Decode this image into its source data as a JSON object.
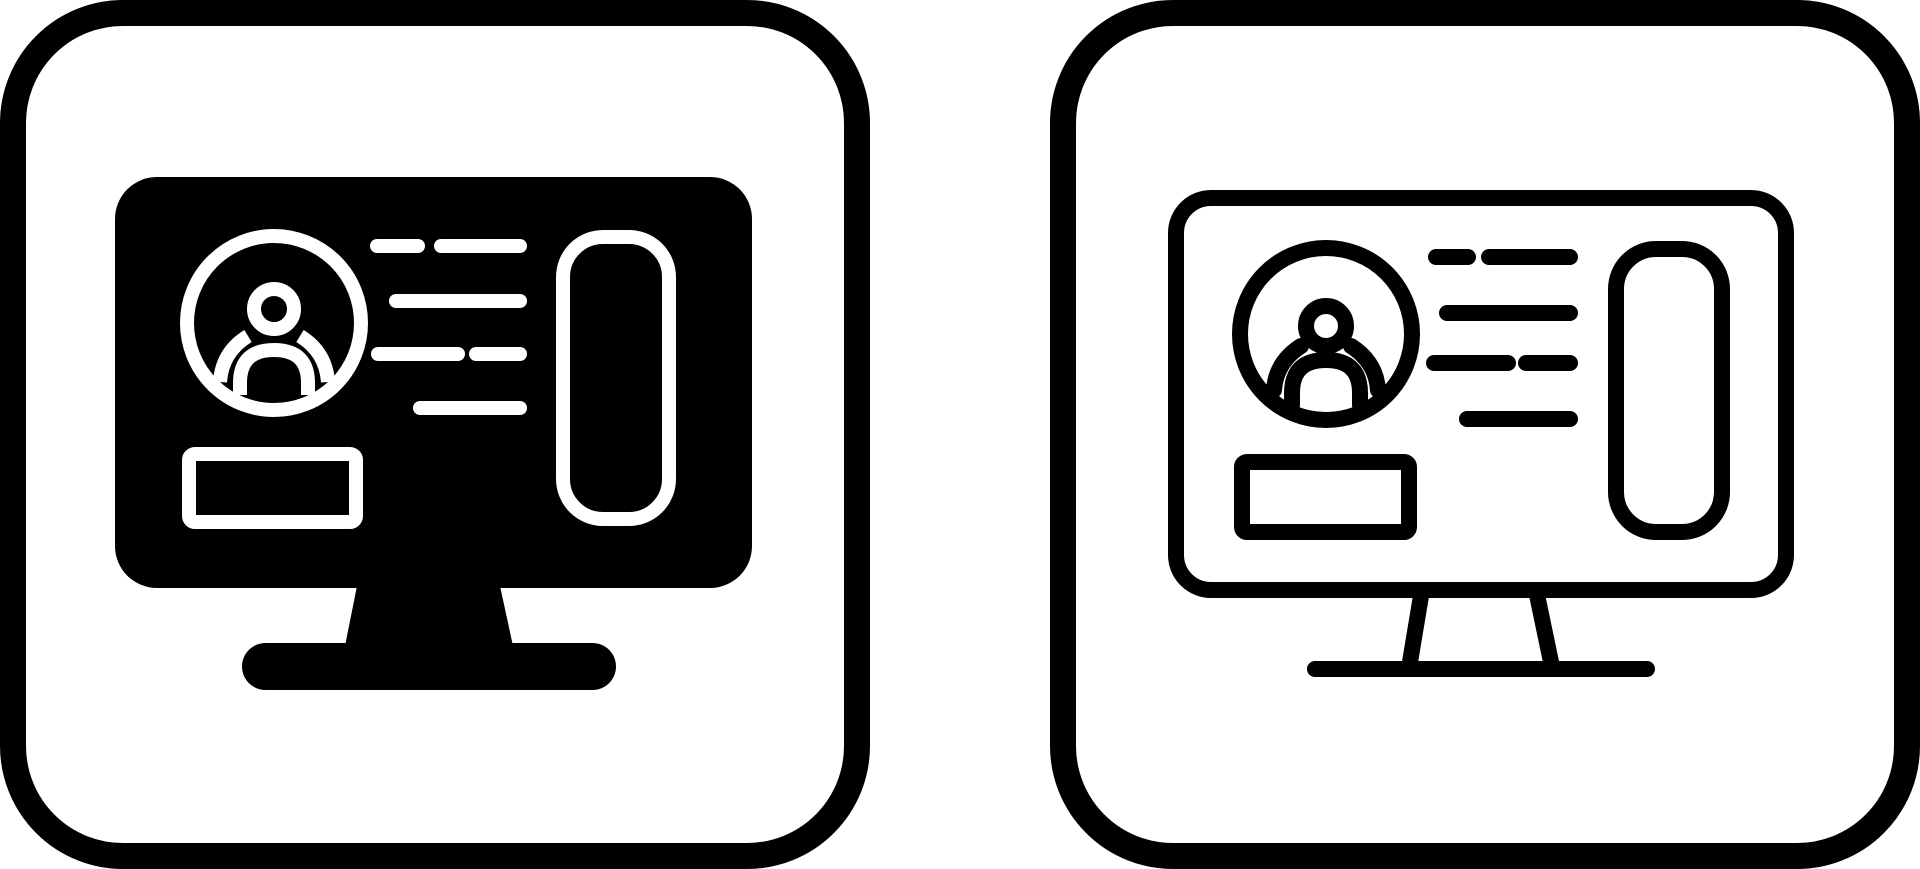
{
  "icons": [
    {
      "name": "profile-monitor-glyph-icon",
      "style": "glyph",
      "color": "#000000",
      "background": "#ffffff"
    },
    {
      "name": "profile-monitor-outline-icon",
      "style": "outline",
      "color": "#000000",
      "background": "#ffffff"
    }
  ]
}
